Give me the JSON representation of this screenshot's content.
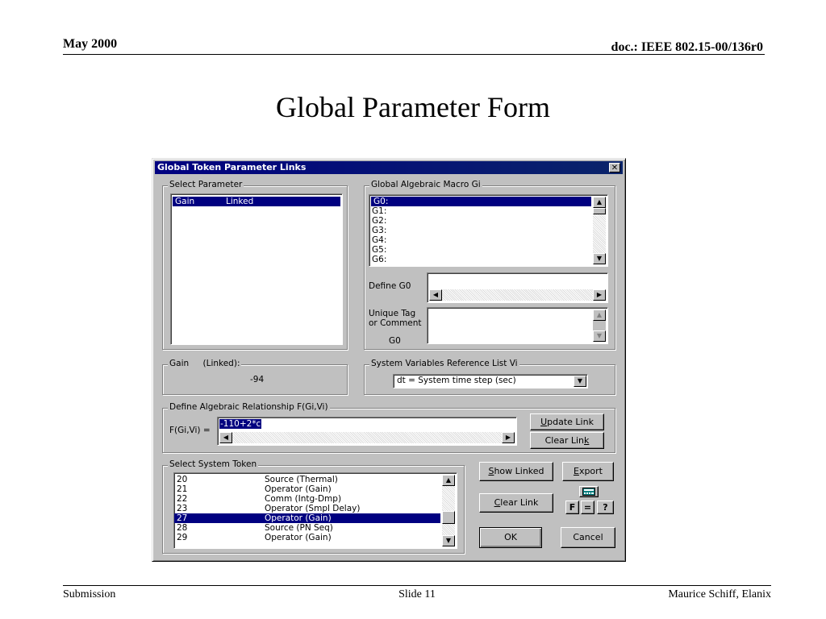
{
  "slide": {
    "date": "May 2000",
    "doc": "doc.: IEEE 802.15-00/136r0",
    "title": "Global Parameter Form",
    "footer_left": "Submission",
    "footer_center": "Slide 11",
    "footer_right": "Maurice Schiff, Elanix"
  },
  "dialog": {
    "title": "Global Token Parameter Links",
    "close_glyph": "✕",
    "select_parameter": {
      "label": "Select Parameter",
      "rows": [
        {
          "name": "Gain",
          "status": "Linked"
        }
      ]
    },
    "macro": {
      "label": "Global Algebraic Macro Gi",
      "items": [
        "G0:",
        "G1:",
        "G2:",
        "G3:",
        "G4:",
        "G5:",
        "G6:"
      ]
    },
    "define_label": "Define G0",
    "unique_tag_label_1": "Unique Tag",
    "unique_tag_label_2": "or Comment",
    "unique_tag_id": "G0",
    "gain_group": {
      "label_name": "Gain",
      "label_status": "(Linked):",
      "value": "-94"
    },
    "sysvars": {
      "label": "System Variables Reference List Vi",
      "selected": "dt = System time step (sec)"
    },
    "relationship": {
      "label": "Define Algebraic Relationship F(Gi,Vi)",
      "field_label": "F(Gi,Vi) =",
      "value": "-110+2*c",
      "update_link": {
        "u": "U",
        "rest": "pdate Link"
      },
      "clear_link": {
        "pre": "Clear Lin",
        "u": "k"
      }
    },
    "tokens": {
      "label": "Select System Token",
      "rows": [
        {
          "id": "20",
          "name": "Source (Thermal)"
        },
        {
          "id": "21",
          "name": "Operator (Gain)"
        },
        {
          "id": "22",
          "name": "Comm (Intg-Dmp)"
        },
        {
          "id": "23",
          "name": "Operator (Smpl Delay)"
        },
        {
          "id": "27",
          "name": "Operator (Gain)"
        },
        {
          "id": "28",
          "name": "Source (PN Seq)"
        },
        {
          "id": "29",
          "name": "Operator (Gain)"
        }
      ]
    },
    "buttons": {
      "show_linked": {
        "u": "S",
        "rest": "how Linked"
      },
      "export": {
        "u": "E",
        "rest": "xport"
      },
      "clear_link": {
        "u": "C",
        "rest": "lear Link"
      },
      "f": "F",
      "eq": "=",
      "help": "?",
      "ok": "OK",
      "cancel": "Cancel"
    }
  }
}
